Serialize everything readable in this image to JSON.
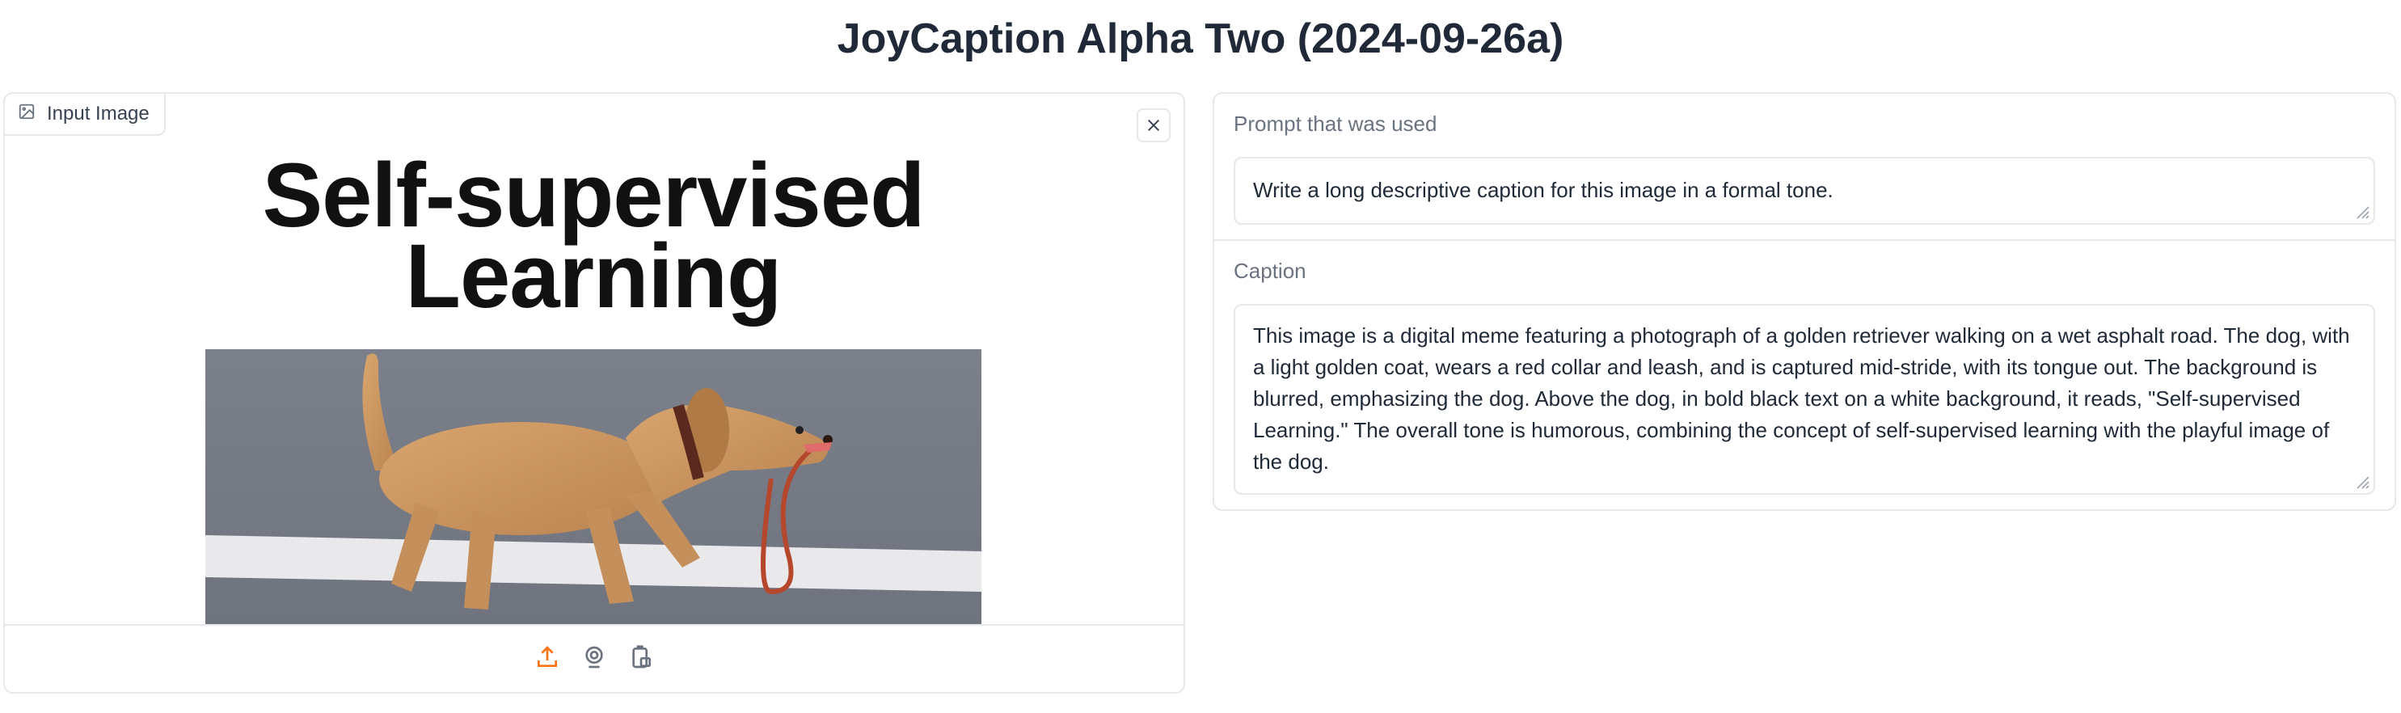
{
  "app": {
    "title": "JoyCaption Alpha Two (2024-09-26a)"
  },
  "input_image": {
    "label": "Input Image",
    "meme_line1": "Self-supervised",
    "meme_line2": "Learning",
    "toolbar_icons": [
      "upload-icon",
      "webcam-icon",
      "paste-clipboard-icon"
    ]
  },
  "prompt": {
    "label": "Prompt that was used",
    "value": "Write a long descriptive caption for this image in a formal tone."
  },
  "caption": {
    "label": "Caption",
    "value": "This image is a digital meme featuring a photograph of a golden retriever walking on a wet asphalt road. The dog, with a light golden coat, wears a red collar and leash, and is captured mid-stride, with its tongue out. The background is blurred, emphasizing the dog. Above the dog, in bold black text on a white background, it reads, \"Self-supervised Learning.\" The overall tone is humorous, combining the concept of self-supervised learning with the playful image of the dog."
  },
  "colors": {
    "accent": "#f97316",
    "border": "#e5e7eb",
    "text": "#1f2937",
    "muted": "#6b7280"
  }
}
